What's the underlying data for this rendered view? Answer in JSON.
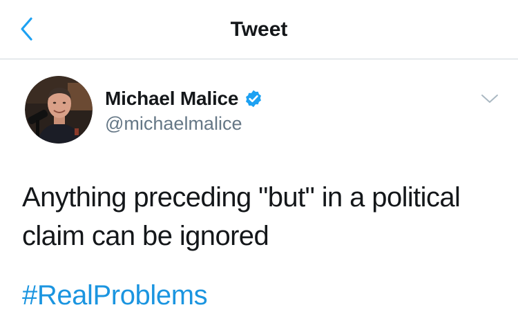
{
  "header": {
    "title": "Tweet",
    "back_icon": "chevron-left-icon",
    "accent_color": "#1da1f2"
  },
  "tweet": {
    "author": {
      "display_name": "Michael Malice",
      "handle": "@michaelmalice",
      "verified": true,
      "verified_icon": "verified-badge-icon"
    },
    "text": "Anything preceding \"but\" in a political claim can be ignored",
    "hashtag": "#RealProblems",
    "menu_icon": "chevron-down-icon"
  },
  "colors": {
    "text": "#14171a",
    "secondary_text": "#657786",
    "link": "#1b95e0",
    "divider": "#cfd6db"
  }
}
